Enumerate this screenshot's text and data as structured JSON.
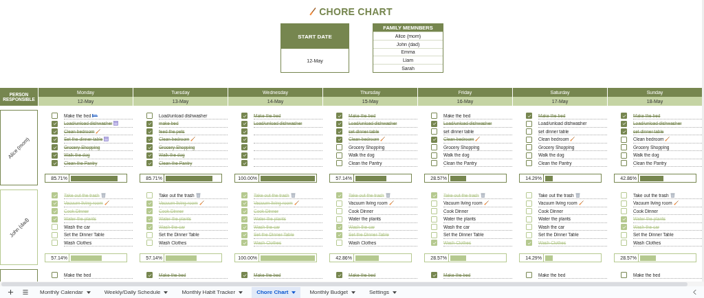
{
  "title": "CHORE CHART",
  "start_date": {
    "label": "START DATE",
    "value": "12-May"
  },
  "family": {
    "title": "FAMILY MEMNBERS",
    "members": [
      "Alice (mom)",
      "John (dad)",
      "Emma",
      "Liam",
      "Sarah"
    ]
  },
  "header": {
    "person_label": "PERSON RESPONSIBLE",
    "days": [
      {
        "day": "Monday",
        "date": "12-May"
      },
      {
        "day": "Tuesday",
        "date": "13-May"
      },
      {
        "day": "Wednesday",
        "date": "14-May"
      },
      {
        "day": "Thursday",
        "date": "15-May"
      },
      {
        "day": "Friday",
        "date": "16-May"
      },
      {
        "day": "Saturday",
        "date": "17-May"
      },
      {
        "day": "Sunday",
        "date": "18-May"
      }
    ]
  },
  "people": [
    {
      "name": "Alice (mom)",
      "color": "#76864f",
      "days": [
        {
          "percent": "85.71%",
          "level": 0.8571,
          "tasks": [
            {
              "text": "Make the bed",
              "kind": "bed",
              "checked": false
            },
            {
              "text": "Load/unload dishwasher",
              "kind": "dish",
              "checked": true
            },
            {
              "text": "Clean bedroom",
              "kind": "broom",
              "checked": true
            },
            {
              "text": "Set the dinner table",
              "kind": "dish",
              "checked": true
            },
            {
              "text": "Grocery Shopping",
              "checked": true
            },
            {
              "text": "Walk the dog",
              "checked": true
            },
            {
              "text": "Clean the Pantry",
              "checked": true
            }
          ]
        },
        {
          "percent": "85.71%",
          "level": 0.8571,
          "tasks": [
            {
              "text": "Load/unload dishwasher",
              "checked": false
            },
            {
              "text": "make bed",
              "checked": true
            },
            {
              "text": "feed the pets",
              "checked": true
            },
            {
              "text": "Clean bedroom",
              "kind": "broom",
              "checked": true
            },
            {
              "text": "Grocery Shopping",
              "checked": true
            },
            {
              "text": "Walk the dog",
              "checked": true
            },
            {
              "text": "Clean the Pantry",
              "checked": true
            }
          ]
        },
        {
          "percent": "100.00%",
          "level": 1,
          "tasks": [
            {
              "text": "Make the bed",
              "checked": true
            },
            {
              "text": "Load/unload dishwasher",
              "checked": true
            },
            {
              "checked": true
            },
            {
              "checked": true
            },
            {
              "checked": true
            },
            {
              "checked": true
            },
            {
              "checked": true
            }
          ]
        },
        {
          "percent": "57.14%",
          "level": 0.5714,
          "tasks": [
            {
              "text": "Make the bed",
              "checked": true
            },
            {
              "text": "Load/unload dishwasher",
              "checked": true
            },
            {
              "text": "set dinner table",
              "checked": true
            },
            {
              "text": "Clean bedroom",
              "kind": "broom",
              "checked": true
            },
            {
              "text": "Grocery Shopping",
              "checked": false
            },
            {
              "text": "Walk the dog",
              "checked": false
            },
            {
              "text": "Clean the Pantry",
              "checked": false
            }
          ]
        },
        {
          "percent": "28.57%",
          "level": 0.2857,
          "tasks": [
            {
              "text": "Make the bed",
              "checked": false
            },
            {
              "text": "Load/unload dishwasher",
              "checked": true
            },
            {
              "text": "set dinner table",
              "checked": false
            },
            {
              "text": "Clean bedroom",
              "kind": "broom",
              "checked": true
            },
            {
              "text": "Grocery Shopping",
              "checked": false
            },
            {
              "text": "Walk the dog",
              "checked": false
            },
            {
              "text": "Clean the Pantry",
              "checked": false
            }
          ]
        },
        {
          "percent": "14.29%",
          "level": 0.1429,
          "tasks": [
            {
              "text": "Make the bed",
              "checked": true
            },
            {
              "text": "Load/unload dishwasher",
              "checked": false
            },
            {
              "text": "set dinner table",
              "checked": false
            },
            {
              "text": "Clean bedroom",
              "kind": "broom",
              "checked": false
            },
            {
              "text": "Grocery Shopping",
              "checked": false
            },
            {
              "text": "Walk the dog",
              "checked": false
            },
            {
              "text": "Clean the Pantry",
              "checked": false
            }
          ]
        },
        {
          "percent": "42.86%",
          "level": 0.4286,
          "tasks": [
            {
              "text": "Make the bed",
              "checked": true
            },
            {
              "text": "Load/unload dishwasher",
              "checked": true
            },
            {
              "text": "set dinner table",
              "checked": true
            },
            {
              "text": "Clean bedroom",
              "kind": "broom",
              "checked": false
            },
            {
              "text": "Grocery Shopping",
              "checked": false
            },
            {
              "text": "Walk the dog",
              "checked": false
            },
            {
              "text": "Clean the Pantry",
              "checked": false
            }
          ]
        }
      ]
    },
    {
      "name": "John (dad)",
      "color": "#b5c98f",
      "days": [
        {
          "percent": "57.14%",
          "level": 0.5714,
          "tasks": [
            {
              "text": "Take out the trash",
              "kind": "trash",
              "checked": true
            },
            {
              "text": "Vacuum living room",
              "kind": "broom",
              "checked": true
            },
            {
              "text": "Cook Dinner",
              "checked": true
            },
            {
              "text": "Water the plants",
              "checked": true
            },
            {
              "text": "Wash the car",
              "checked": false
            },
            {
              "text": "Set the Dinner Table",
              "checked": false
            },
            {
              "text": "Wash Clothes",
              "checked": false
            }
          ]
        },
        {
          "percent": "57.14%",
          "level": 0.5714,
          "tasks": [
            {
              "text": "Take out the trash",
              "kind": "trash",
              "checked": false
            },
            {
              "text": "Vacuum living room",
              "kind": "broom",
              "checked": true
            },
            {
              "text": "Cook Dinner",
              "checked": true
            },
            {
              "text": "Water the plants",
              "checked": true
            },
            {
              "text": "Wash the car",
              "checked": true
            },
            {
              "text": "Set the Dinner Table",
              "checked": false
            },
            {
              "text": "Wash Clothes",
              "checked": false
            }
          ]
        },
        {
          "percent": "100.00%",
          "level": 1,
          "tasks": [
            {
              "text": "Take out the trash",
              "kind": "trash",
              "checked": true
            },
            {
              "text": "Vacuum living room",
              "kind": "broom",
              "checked": true
            },
            {
              "text": "Cook Dinner",
              "checked": true
            },
            {
              "text": "Water the plants",
              "checked": true
            },
            {
              "text": "Wash the car",
              "checked": true
            },
            {
              "text": "Set the Dinner Table",
              "checked": true
            },
            {
              "text": "Wash Clothes",
              "checked": true
            }
          ]
        },
        {
          "percent": "42.86%",
          "level": 0.4286,
          "tasks": [
            {
              "text": "Take out the trash",
              "kind": "trash",
              "checked": true
            },
            {
              "text": "Vacuum living room",
              "kind": "broom",
              "checked": false
            },
            {
              "text": "Cook Dinner",
              "checked": false
            },
            {
              "text": "Water the plants",
              "checked": false
            },
            {
              "text": "Wash the car",
              "checked": true
            },
            {
              "text": "Set the Dinner Table",
              "checked": true
            },
            {
              "text": "Wash Clothes",
              "checked": false
            }
          ]
        },
        {
          "percent": "28.57%",
          "level": 0.2857,
          "tasks": [
            {
              "text": "Take out the trash",
              "kind": "trash",
              "checked": true
            },
            {
              "text": "Vacuum living room",
              "kind": "broom",
              "checked": false
            },
            {
              "text": "Cook Dinner",
              "checked": false
            },
            {
              "text": "Water the plants",
              "checked": false
            },
            {
              "text": "Wash the car",
              "checked": false
            },
            {
              "text": "Set the Dinner Table",
              "checked": false
            },
            {
              "text": "Wash Clothes",
              "checked": true
            }
          ]
        },
        {
          "percent": "14.29%",
          "level": 0.1429,
          "tasks": [
            {
              "text": "Take out the trash",
              "kind": "trash",
              "checked": false
            },
            {
              "text": "Vacuum living room",
              "kind": "broom",
              "checked": false
            },
            {
              "text": "Cook Dinner",
              "checked": false
            },
            {
              "text": "Water the plants",
              "checked": false
            },
            {
              "text": "Wash the car",
              "checked": false
            },
            {
              "text": "Set the Dinner Table",
              "checked": false
            },
            {
              "text": "Wash Clothes",
              "checked": true
            }
          ]
        },
        {
          "percent": "28.57%",
          "level": 0.2857,
          "tasks": [
            {
              "text": "Take out the trash",
              "kind": "trash",
              "checked": false
            },
            {
              "text": "Vacuum living room",
              "kind": "broom",
              "checked": false
            },
            {
              "text": "Cook Dinner",
              "checked": false
            },
            {
              "text": "Water the plants",
              "checked": true
            },
            {
              "text": "Wash the car",
              "checked": true
            },
            {
              "text": "Set the Dinner Table",
              "checked": false
            },
            {
              "text": "Wash Clothes",
              "checked": false
            }
          ]
        }
      ]
    },
    {
      "color": "#76864f",
      "days": [
        {
          "tasks": [
            {
              "text": "Make the bed",
              "checked": false
            }
          ]
        },
        {
          "tasks": [
            {
              "text": "Make the bed",
              "checked": true
            }
          ]
        },
        {
          "tasks": [
            {
              "text": "Make the bed",
              "checked": true
            }
          ]
        },
        {
          "tasks": [
            {
              "text": "Make the bed",
              "checked": true
            }
          ]
        },
        {
          "tasks": [
            {
              "text": "Make the bed",
              "checked": true
            }
          ]
        },
        {
          "tasks": [
            {
              "text": "Make the bed",
              "checked": false
            }
          ]
        },
        {
          "tasks": [
            {
              "text": "Make the bed",
              "checked": false
            }
          ]
        }
      ]
    }
  ],
  "sheet_tabs": [
    {
      "label": "Monthly Calendar",
      "selected": false
    },
    {
      "label": "Weekly/Daily Schedule",
      "selected": false
    },
    {
      "label": "Monthly Habit Tracker",
      "selected": false
    },
    {
      "label": "Chore Chart",
      "selected": true
    },
    {
      "label": "Monthly Budget",
      "selected": false
    },
    {
      "label": "Settings",
      "selected": false
    }
  ]
}
